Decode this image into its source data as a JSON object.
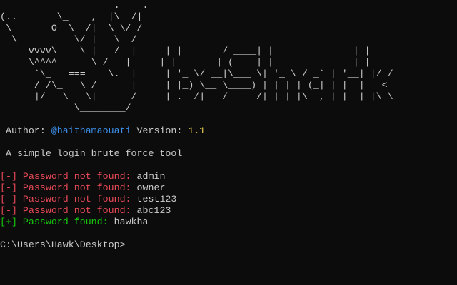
{
  "banner": {
    "lines": [
      "  _________         .    .",
      "(..       \\_    ,  |\\  /|",
      " \\       O  \\  /|  \\ \\/ /",
      "  \\______    \\/ |   \\  /      _         _____ _                _",
      "     vvvv\\    \\ |   /  |     | |       / ____| |              | |",
      "     \\^^^^  ==  \\_/   |     | |__  ___| (___ | |__   __ _ _ __| | __",
      "      `\\_   ===    \\.  |     | '_ \\/ __|\\___ \\| '_ \\ / _` | '__| |/ /",
      "      / /\\_   \\ /      |     | |_) \\__ \\____) | | | | (_| | |  |   <",
      "      |/   \\_  \\|      /     |_.__/|___/_____/|_| |_|\\__,_|_|  |_|\\_\\",
      "             \\________/"
    ]
  },
  "author": {
    "label": " Author: ",
    "handle": "@haithamaouati",
    "version_label": " Version: ",
    "version": "1.1"
  },
  "description": " A simple login brute force tool",
  "results": [
    {
      "tag": "[-]",
      "message": " Password not found: ",
      "value": "admin",
      "status": "fail"
    },
    {
      "tag": "[-]",
      "message": " Password not found: ",
      "value": "owner",
      "status": "fail"
    },
    {
      "tag": "[-]",
      "message": " Password not found: ",
      "value": "test123",
      "status": "fail"
    },
    {
      "tag": "[-]",
      "message": " Password not found: ",
      "value": "abc123",
      "status": "fail"
    },
    {
      "tag": "[+]",
      "message": " Password found: ",
      "value": "hawkha",
      "status": "success"
    }
  ],
  "prompt": "C:\\Users\\Hawk\\Desktop>",
  "colors": {
    "background": "#0c0c0c",
    "text": "#cccccc",
    "handle": "#3b8eea",
    "version": "#e5c84e",
    "fail": "#e74856",
    "success": "#16c60c"
  }
}
